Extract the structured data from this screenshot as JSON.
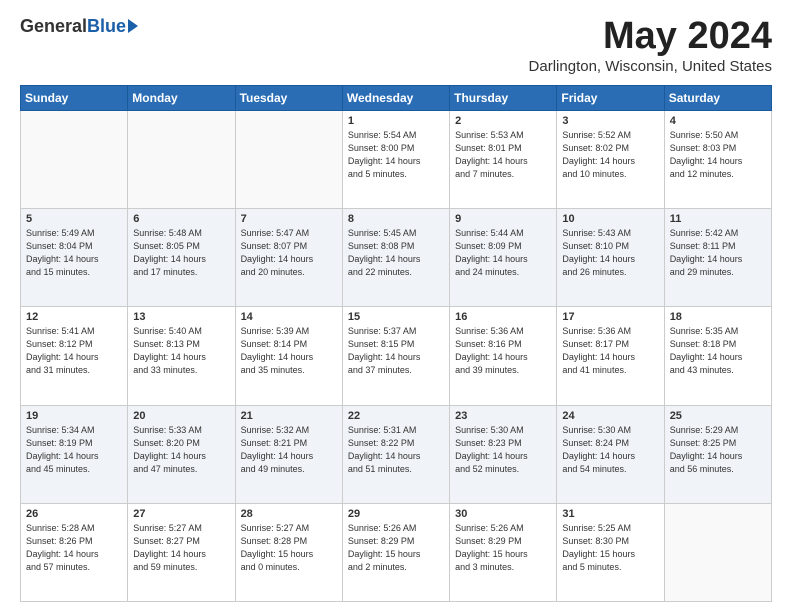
{
  "header": {
    "logo_general": "General",
    "logo_blue": "Blue",
    "month": "May 2024",
    "location": "Darlington, Wisconsin, United States"
  },
  "weekdays": [
    "Sunday",
    "Monday",
    "Tuesday",
    "Wednesday",
    "Thursday",
    "Friday",
    "Saturday"
  ],
  "weeks": [
    [
      {
        "day": "",
        "info": ""
      },
      {
        "day": "",
        "info": ""
      },
      {
        "day": "",
        "info": ""
      },
      {
        "day": "1",
        "info": "Sunrise: 5:54 AM\nSunset: 8:00 PM\nDaylight: 14 hours\nand 5 minutes."
      },
      {
        "day": "2",
        "info": "Sunrise: 5:53 AM\nSunset: 8:01 PM\nDaylight: 14 hours\nand 7 minutes."
      },
      {
        "day": "3",
        "info": "Sunrise: 5:52 AM\nSunset: 8:02 PM\nDaylight: 14 hours\nand 10 minutes."
      },
      {
        "day": "4",
        "info": "Sunrise: 5:50 AM\nSunset: 8:03 PM\nDaylight: 14 hours\nand 12 minutes."
      }
    ],
    [
      {
        "day": "5",
        "info": "Sunrise: 5:49 AM\nSunset: 8:04 PM\nDaylight: 14 hours\nand 15 minutes."
      },
      {
        "day": "6",
        "info": "Sunrise: 5:48 AM\nSunset: 8:05 PM\nDaylight: 14 hours\nand 17 minutes."
      },
      {
        "day": "7",
        "info": "Sunrise: 5:47 AM\nSunset: 8:07 PM\nDaylight: 14 hours\nand 20 minutes."
      },
      {
        "day": "8",
        "info": "Sunrise: 5:45 AM\nSunset: 8:08 PM\nDaylight: 14 hours\nand 22 minutes."
      },
      {
        "day": "9",
        "info": "Sunrise: 5:44 AM\nSunset: 8:09 PM\nDaylight: 14 hours\nand 24 minutes."
      },
      {
        "day": "10",
        "info": "Sunrise: 5:43 AM\nSunset: 8:10 PM\nDaylight: 14 hours\nand 26 minutes."
      },
      {
        "day": "11",
        "info": "Sunrise: 5:42 AM\nSunset: 8:11 PM\nDaylight: 14 hours\nand 29 minutes."
      }
    ],
    [
      {
        "day": "12",
        "info": "Sunrise: 5:41 AM\nSunset: 8:12 PM\nDaylight: 14 hours\nand 31 minutes."
      },
      {
        "day": "13",
        "info": "Sunrise: 5:40 AM\nSunset: 8:13 PM\nDaylight: 14 hours\nand 33 minutes."
      },
      {
        "day": "14",
        "info": "Sunrise: 5:39 AM\nSunset: 8:14 PM\nDaylight: 14 hours\nand 35 minutes."
      },
      {
        "day": "15",
        "info": "Sunrise: 5:37 AM\nSunset: 8:15 PM\nDaylight: 14 hours\nand 37 minutes."
      },
      {
        "day": "16",
        "info": "Sunrise: 5:36 AM\nSunset: 8:16 PM\nDaylight: 14 hours\nand 39 minutes."
      },
      {
        "day": "17",
        "info": "Sunrise: 5:36 AM\nSunset: 8:17 PM\nDaylight: 14 hours\nand 41 minutes."
      },
      {
        "day": "18",
        "info": "Sunrise: 5:35 AM\nSunset: 8:18 PM\nDaylight: 14 hours\nand 43 minutes."
      }
    ],
    [
      {
        "day": "19",
        "info": "Sunrise: 5:34 AM\nSunset: 8:19 PM\nDaylight: 14 hours\nand 45 minutes."
      },
      {
        "day": "20",
        "info": "Sunrise: 5:33 AM\nSunset: 8:20 PM\nDaylight: 14 hours\nand 47 minutes."
      },
      {
        "day": "21",
        "info": "Sunrise: 5:32 AM\nSunset: 8:21 PM\nDaylight: 14 hours\nand 49 minutes."
      },
      {
        "day": "22",
        "info": "Sunrise: 5:31 AM\nSunset: 8:22 PM\nDaylight: 14 hours\nand 51 minutes."
      },
      {
        "day": "23",
        "info": "Sunrise: 5:30 AM\nSunset: 8:23 PM\nDaylight: 14 hours\nand 52 minutes."
      },
      {
        "day": "24",
        "info": "Sunrise: 5:30 AM\nSunset: 8:24 PM\nDaylight: 14 hours\nand 54 minutes."
      },
      {
        "day": "25",
        "info": "Sunrise: 5:29 AM\nSunset: 8:25 PM\nDaylight: 14 hours\nand 56 minutes."
      }
    ],
    [
      {
        "day": "26",
        "info": "Sunrise: 5:28 AM\nSunset: 8:26 PM\nDaylight: 14 hours\nand 57 minutes."
      },
      {
        "day": "27",
        "info": "Sunrise: 5:27 AM\nSunset: 8:27 PM\nDaylight: 14 hours\nand 59 minutes."
      },
      {
        "day": "28",
        "info": "Sunrise: 5:27 AM\nSunset: 8:28 PM\nDaylight: 15 hours\nand 0 minutes."
      },
      {
        "day": "29",
        "info": "Sunrise: 5:26 AM\nSunset: 8:29 PM\nDaylight: 15 hours\nand 2 minutes."
      },
      {
        "day": "30",
        "info": "Sunrise: 5:26 AM\nSunset: 8:29 PM\nDaylight: 15 hours\nand 3 minutes."
      },
      {
        "day": "31",
        "info": "Sunrise: 5:25 AM\nSunset: 8:30 PM\nDaylight: 15 hours\nand 5 minutes."
      },
      {
        "day": "",
        "info": ""
      }
    ]
  ]
}
